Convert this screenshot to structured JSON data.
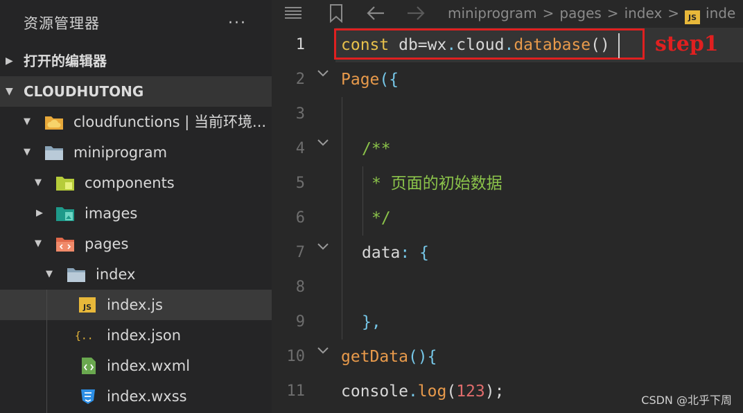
{
  "sidebar": {
    "title": "资源管理器",
    "more": "···",
    "open_editors": "打开的编辑器",
    "project": "CLOUDHUTONG",
    "tree": [
      {
        "label": "cloudfunctions | 当前环境..."
      },
      {
        "label": "miniprogram"
      },
      {
        "label": "components"
      },
      {
        "label": "images"
      },
      {
        "label": "pages"
      },
      {
        "label": "index"
      },
      {
        "label": "index.js"
      },
      {
        "label": "index.json"
      },
      {
        "label": "index.wxml"
      },
      {
        "label": "index.wxss"
      }
    ]
  },
  "editor": {
    "breadcrumb": [
      "miniprogram",
      "pages",
      "index",
      "inde"
    ],
    "breadcrumb_js_badge": "JS",
    "line_numbers": [
      "1",
      "2",
      "3",
      "4",
      "5",
      "6",
      "7",
      "8",
      "9",
      "10",
      "11"
    ],
    "annotation": "step1",
    "code": {
      "l1": [
        "const",
        "db=wx",
        ".",
        "cloud",
        ".",
        "database",
        "()"
      ],
      "l2": [
        "Page",
        "({"
      ],
      "l4": "/**",
      "l5": "* 页面的初始数据",
      "l6": "*/",
      "l7": [
        "data",
        ": {"
      ],
      "l9": "},",
      "l10": [
        "getData",
        "(){"
      ],
      "l11": [
        "console",
        ".",
        "log",
        "(",
        "123",
        ");"
      ]
    }
  },
  "watermark": "CSDN @北乎下周",
  "colors": {
    "keyword": "#e8c14b",
    "punct": "#76c7e8",
    "method": "#e89a4b",
    "comment": "#8bc34a",
    "number": "#e06c6c",
    "annotation": "#e02020"
  }
}
